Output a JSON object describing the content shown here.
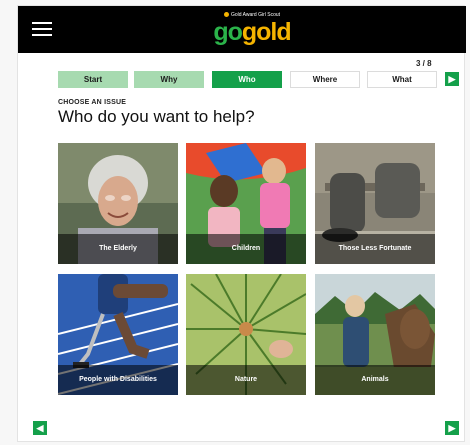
{
  "header": {
    "logo_tagline": "Gold Award Girl Scout",
    "logo_go": "go",
    "logo_gold": "gold",
    "menu_icon": "hamburger-menu-icon"
  },
  "progress": {
    "counter": "3 / 8",
    "steps": [
      {
        "label": "Start",
        "state": "done"
      },
      {
        "label": "Why",
        "state": "done"
      },
      {
        "label": "Who",
        "state": "active"
      },
      {
        "label": "Where",
        "state": "pending"
      },
      {
        "label": "What",
        "state": "pending"
      }
    ],
    "next_icon": "chevron-right-icon"
  },
  "content": {
    "kicker": "CHOOSE AN ISSUE",
    "title": "Who do you want to help?",
    "tiles": [
      {
        "label": "The Elderly"
      },
      {
        "label": "Children"
      },
      {
        "label": "Those Less Fortunate"
      },
      {
        "label": "People with Disabilities"
      },
      {
        "label": "Nature"
      },
      {
        "label": "Animals"
      }
    ]
  },
  "footer": {
    "prev_icon": "chevron-left-icon",
    "next_icon": "chevron-right-icon"
  },
  "colors": {
    "accent_green": "#14a04a",
    "done_green": "#a7dab0",
    "logo_gold": "#f5b400",
    "logo_green": "#2bb34a",
    "topbar": "#000000"
  }
}
